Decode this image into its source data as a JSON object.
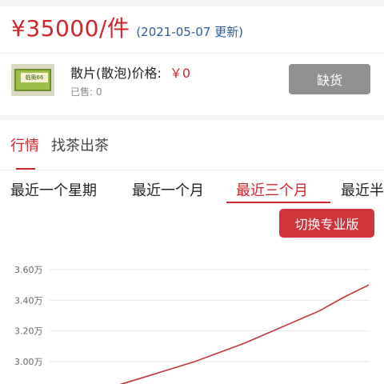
{
  "header": {
    "price": "¥35000/件",
    "date_note": "(2021-05-07 更新)"
  },
  "product": {
    "thumb_label": "临奥66",
    "name_label": "散片(散泡)价格:",
    "price_value": "￥0",
    "sold_text": "已售: 0",
    "out_of_stock_button": "缺货"
  },
  "tabs": [
    {
      "label": "行情",
      "active": true
    },
    {
      "label": "找茶出茶",
      "active": false
    }
  ],
  "range_tabs": [
    {
      "label": "最近一个星期",
      "active": false
    },
    {
      "label": "最近一个月",
      "active": false
    },
    {
      "label": "最近三个月",
      "active": true
    },
    {
      "label": "最近半",
      "active": false
    }
  ],
  "pro_button": "切换专业版",
  "colors": {
    "accent_red": "#d0262c",
    "date_blue": "#2a5d9a",
    "disabled_gray": "#909090",
    "grid": "#e6e6e6"
  },
  "chart_data": {
    "type": "line",
    "ylim": [
      2.9,
      3.65
    ],
    "y_ticks": [
      "3.60万",
      "3.40万",
      "3.20万",
      "3.00万"
    ],
    "y_tick_values": [
      3.6,
      3.4,
      3.2,
      3.0
    ],
    "series": [
      {
        "color": "#c8323a",
        "x": [
          0,
          0.1,
          0.2,
          0.3,
          0.4,
          0.5,
          0.6,
          0.7,
          0.8,
          0.9,
          1.0
        ],
        "values": [
          2.85,
          2.9,
          2.95,
          3.0,
          3.06,
          3.12,
          3.19,
          3.26,
          3.33,
          3.42,
          3.5
        ]
      }
    ]
  }
}
